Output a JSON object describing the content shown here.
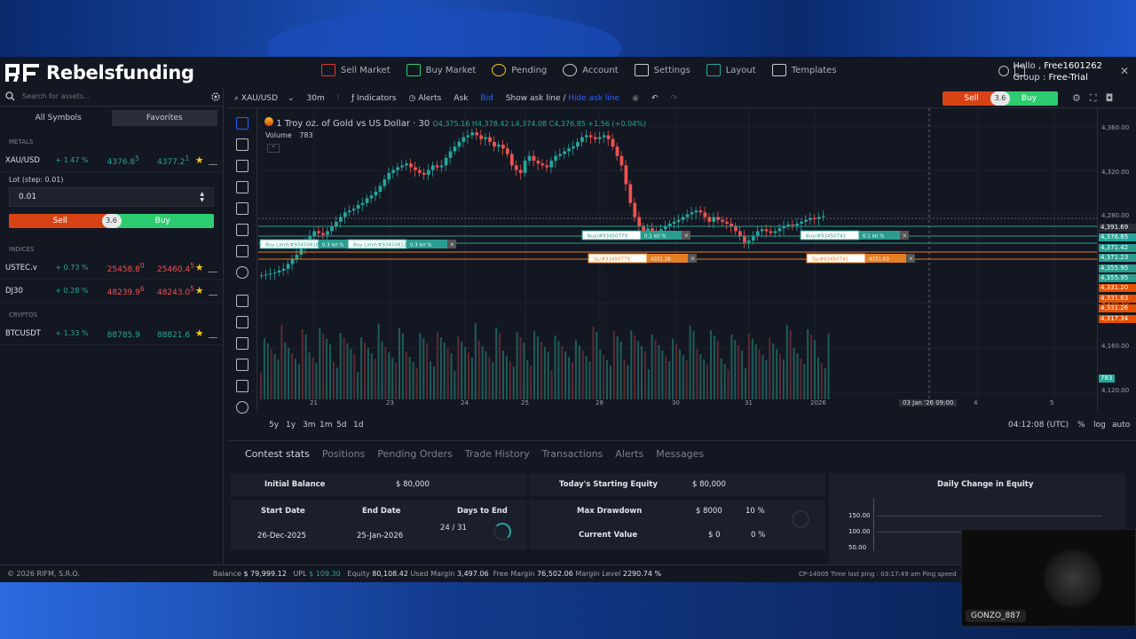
{
  "brand": {
    "name": "Rebelsfunding"
  },
  "nav": [
    {
      "label": "Sell Market",
      "icon": "sell-market-icon",
      "color": "#e53935"
    },
    {
      "label": "Buy Market",
      "icon": "buy-market-icon",
      "color": "#2ecc71"
    },
    {
      "label": "Pending",
      "icon": "pending-icon",
      "color": "#f5c518"
    },
    {
      "label": "Account",
      "icon": "account-icon",
      "color": "#cccccc"
    },
    {
      "label": "Settings",
      "icon": "settings-icon",
      "color": "#cccccc"
    },
    {
      "label": "Layout",
      "icon": "layout-icon",
      "color": "#26a69a"
    },
    {
      "label": "Templates",
      "icon": "templates-icon",
      "color": "#cccccc"
    }
  ],
  "user": {
    "hello": "Hello ,",
    "name": "Free1601262",
    "group_label": "Group :",
    "group": "Free-Trial"
  },
  "sidebar": {
    "search_placeholder": "Search for assets...",
    "tabs": [
      "All Symbols",
      "Favorites"
    ],
    "categories": {
      "metals": "METALS",
      "indices": "INDICES",
      "cryptos": "CRYPTOS"
    },
    "symbols": [
      {
        "name": "XAU/USD",
        "change": "+ 1.47 %",
        "bid": "4376.8",
        "bid_sup": "5",
        "ask": "4377.2",
        "ask_sup": "1",
        "bid_color": "green"
      },
      {
        "name": "USTEC.v",
        "change": "+ 0.73 %",
        "bid": "25458.8",
        "bid_sup": "0",
        "ask": "25460.4",
        "ask_sup": "5",
        "bid_color": "red"
      },
      {
        "name": "DJ30",
        "change": "+ 0.28 %",
        "bid": "48239.9",
        "bid_sup": "6",
        "ask": "48243.0",
        "ask_sup": "5",
        "bid_color": "red"
      },
      {
        "name": "BTCUSDT",
        "change": "+ 1.33 %",
        "bid": "88785.9",
        "bid_sup": "",
        "ask": "88821.6",
        "ask_sup": "",
        "bid_color": "green"
      }
    ],
    "lot_label": "Lot (step: 0.01)",
    "lot_value": "0.01",
    "sell": "Sell",
    "buy": "Buy",
    "spread": "3.6"
  },
  "toolbar": {
    "symbol": "XAU/USD",
    "timeframe": "30m",
    "indicators": "Indicators",
    "alerts": "Alerts",
    "ask": "Ask",
    "bid": "Bid",
    "show_ask": "Show ask line /",
    "hide_ask": "Hide ask line",
    "sell": "Sell",
    "buy": "Buy",
    "spread": "3.6"
  },
  "chart_info": {
    "title": "1 Troy oz. of Gold vs US Dollar · 30",
    "ohlc": "O4,375.16 H4,378.42 L4,374.08 C4,376.85 +1.56 (+0.04%)",
    "volume_label": "Volume",
    "volume_value": "783"
  },
  "chart_data": {
    "type": "candlestick",
    "x_labels": [
      "21",
      "23",
      "24",
      "25",
      "28",
      "30",
      "31",
      "2026",
      "03 Jan '26   09:00",
      "4",
      "5"
    ],
    "y_ticks": [
      "4,360.00",
      "4,320.00",
      "4,280.00",
      "4,240.00",
      "4,200.00",
      "4,160.00",
      "4,120.00"
    ],
    "price_labels": [
      {
        "value": "4,391.69",
        "color": "#2a2e39"
      },
      {
        "value": "4,376.85",
        "color": "#26a69a"
      },
      {
        "value": "4,371.42",
        "color": "#2a9d8f"
      },
      {
        "value": "4,371.23",
        "color": "#2a9d8f"
      },
      {
        "value": "4,355.95",
        "color": "#2a9d8f"
      },
      {
        "value": "4,355.95",
        "color": "#2a9d8f"
      },
      {
        "value": "4,331.20",
        "color": "#e65100"
      },
      {
        "value": "4,331.63",
        "color": "#e65100"
      },
      {
        "value": "4,331.26",
        "color": "#e65100"
      },
      {
        "value": "4,317.34",
        "color": "#e65100"
      }
    ],
    "volume_badge": "783",
    "close_path": [
      4283,
      4284,
      4285,
      4286,
      4288,
      4290,
      4295,
      4300,
      4305,
      4312,
      4318,
      4325,
      4330,
      4328,
      4326,
      4330,
      4335,
      4340,
      4345,
      4350,
      4352,
      4354,
      4358,
      4360,
      4365,
      4368,
      4372,
      4378,
      4385,
      4392,
      4395,
      4398,
      4400,
      4402,
      4398,
      4395,
      4392,
      4390,
      4395,
      4400,
      4398,
      4400,
      4408,
      4415,
      4420,
      4425,
      4430,
      4432,
      4435,
      4432,
      4428,
      4430,
      4425,
      4420,
      4422,
      4418,
      4412,
      4400,
      4395,
      4392,
      4405,
      4410,
      4405,
      4402,
      4400,
      4398,
      4405,
      4410,
      4412,
      4415,
      4418,
      4420,
      4425,
      4430,
      4432,
      4430,
      4428,
      4430,
      4432,
      4428,
      4420,
      4410,
      4400,
      4380,
      4360,
      4345,
      4335,
      4330,
      4333,
      4330,
      4328,
      4332,
      4335,
      4338,
      4340,
      4342,
      4345,
      4348,
      4350,
      4352,
      4350,
      4345,
      4340,
      4345,
      4342,
      4340,
      4338,
      4335,
      4330,
      4325,
      4318,
      4320,
      4325,
      4330,
      4332,
      4330,
      4328,
      4330,
      4333,
      4335,
      4337,
      4336,
      4338,
      4340,
      4342,
      4344,
      4343,
      4345,
      4346
    ]
  },
  "orders": [
    {
      "text": "Buy Limit/#93450818",
      "lots": "0.3 lot %"
    },
    {
      "text": "Buy Limit/#93450813",
      "lots": "0.3 lot %"
    },
    {
      "text": "Buy/#93450779",
      "lots": "0.1 lot %"
    },
    {
      "text": "Buy/#93450741",
      "lots": "0.1 lot %"
    },
    {
      "text": "SL/#93450779",
      "lots": "4331.26"
    },
    {
      "text": "SL/#93450741",
      "lots": "4331.63"
    }
  ],
  "timebar": {
    "ranges": [
      "5y",
      "1y",
      "3m",
      "1m",
      "5d",
      "1d"
    ],
    "clock": "04:12:08 (UTC)",
    "pct": "%",
    "log": "log",
    "auto": "auto"
  },
  "bottom": {
    "tabs": [
      "Contest stats",
      "Positions",
      "Pending Orders",
      "Trade History",
      "Transactions",
      "Alerts",
      "Messages"
    ],
    "initial_balance_label": "Initial Balance",
    "initial_balance": "$ 80,000",
    "start_date_label": "Start Date",
    "end_date_label": "End Date",
    "days_to_end_label": "Days to End",
    "start_date": "26-Dec-2025",
    "end_date": "25-Jan-2026",
    "days_to_end": "24 / 31",
    "todays_equity_label": "Today's Starting Equity",
    "todays_equity": "$ 80,000",
    "max_drawdown_label": "Max Drawdown",
    "max_drawdown": "$ 8000",
    "max_drawdown_pct": "10 %",
    "current_value_label": "Current Value",
    "current_value": "$ 0",
    "current_value_pct": "0 %",
    "daily_change_title": "Daily Change in Equity",
    "daily_ticks": [
      "150.00",
      "100.00",
      "50.00"
    ]
  },
  "footer": {
    "copyright": "© 2026 RIFM, S.R.O.",
    "balance_label": "Balance",
    "balance": "$ 79,999.12",
    "upl_label": "UPL",
    "upl": "$ 109.30",
    "equity_label": "Equity",
    "equity": "80,108.42",
    "used_margin_label": "Used Margin",
    "used_margin": "3,497.06",
    "free_margin_label": "Free Margin",
    "free_margin": "76,502.06",
    "margin_level_label": "Margin Level",
    "margin_level": "2290.74 %",
    "ping_text": "CP-14005 Time last ping : 03:17:49 am   Ping speed"
  },
  "webcam": {
    "name": "GONZO_887"
  }
}
